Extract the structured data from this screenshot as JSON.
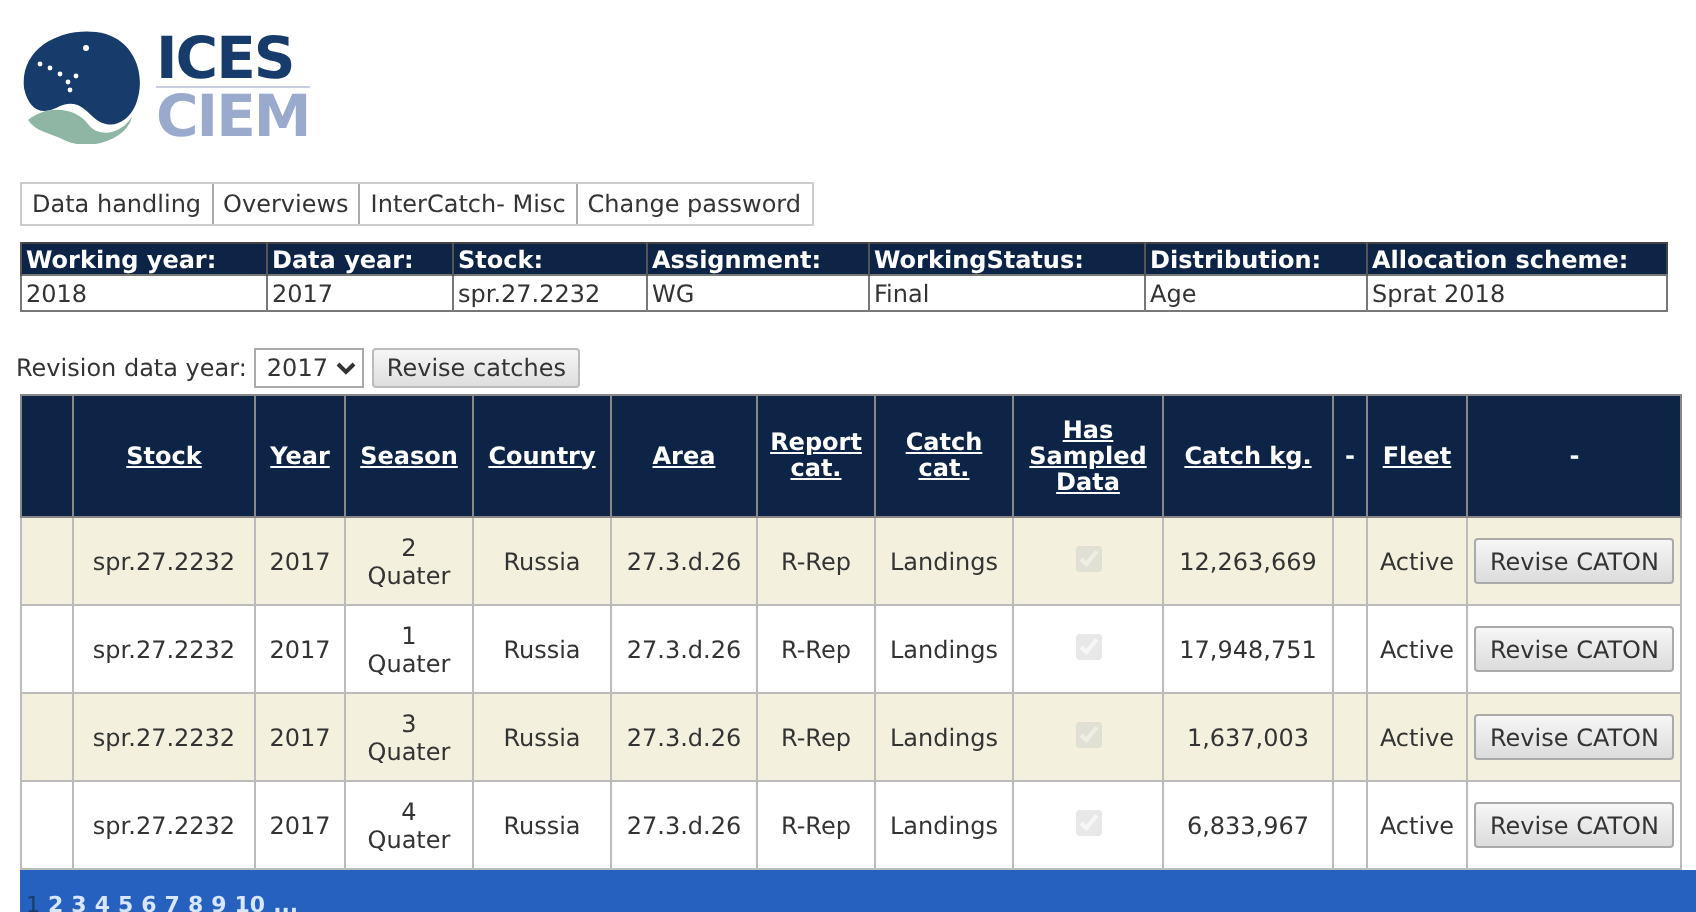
{
  "logo": {
    "line_1": "ICES",
    "line_2": "CIEM"
  },
  "menu": [
    {
      "label": "Data handling"
    },
    {
      "label": "Overviews"
    },
    {
      "label": "InterCatch- Misc"
    },
    {
      "label": "Change password"
    }
  ],
  "info": [
    {
      "label": "Working year:",
      "value": "2018"
    },
    {
      "label": "Data year:",
      "value": "2017"
    },
    {
      "label": "Stock:",
      "value": "spr.27.2232"
    },
    {
      "label": "Assignment:",
      "value": "WG"
    },
    {
      "label": "WorkingStatus:",
      "value": "Final"
    },
    {
      "label": "Distribution:",
      "value": "Age"
    },
    {
      "label": "Allocation scheme:",
      "value": "Sprat 2018"
    }
  ],
  "revision": {
    "label": "Revision data year:",
    "year": "2017",
    "button": "Revise catches"
  },
  "table": {
    "columns": [
      {
        "kind": "blank"
      },
      {
        "label": "Stock",
        "kind": "link"
      },
      {
        "label": "Year",
        "kind": "link"
      },
      {
        "label": "Season",
        "kind": "link"
      },
      {
        "label": "Country",
        "kind": "link"
      },
      {
        "label": "Area",
        "kind": "link"
      },
      {
        "label": "Report cat.",
        "kind": "link"
      },
      {
        "label": "Catch cat.",
        "kind": "link"
      },
      {
        "label": "Has Sampled Data",
        "kind": "link"
      },
      {
        "label": "Catch kg.",
        "kind": "link"
      },
      {
        "label": "-",
        "kind": "text"
      },
      {
        "label": "Fleet",
        "kind": "link"
      },
      {
        "label": "-",
        "kind": "text"
      }
    ],
    "rows": [
      {
        "stock": "spr.27.2232",
        "year": "2017",
        "season_number": "2",
        "season": "Quater",
        "country": "Russia",
        "area": "27.3.d.26",
        "report_cat": "R-Rep",
        "catch_cat": "Landings",
        "has_sampled_data": {
          "checked": true,
          "disabled": true
        },
        "catch_kg": "12,263,669",
        "fleet": "Active",
        "button": "Revise CATON"
      },
      {
        "stock": "spr.27.2232",
        "year": "2017",
        "season_number": "1",
        "season": "Quater",
        "country": "Russia",
        "area": "27.3.d.26",
        "report_cat": "R-Rep",
        "catch_cat": "Landings",
        "has_sampled_data": {
          "checked": true,
          "disabled": true
        },
        "catch_kg": "17,948,751",
        "fleet": "Active",
        "button": "Revise CATON"
      },
      {
        "stock": "spr.27.2232",
        "year": "2017",
        "season_number": "3",
        "season": "Quater",
        "country": "Russia",
        "area": "27.3.d.26",
        "report_cat": "R-Rep",
        "catch_cat": "Landings",
        "has_sampled_data": {
          "checked": true,
          "disabled": true
        },
        "catch_kg": "1,637,003",
        "fleet": "Active",
        "button": "Revise CATON"
      },
      {
        "stock": "spr.27.2232",
        "year": "2017",
        "season_number": "4",
        "season": "Quater",
        "country": "Russia",
        "area": "27.3.d.26",
        "report_cat": "R-Rep",
        "catch_cat": "Landings",
        "has_sampled_data": {
          "checked": true,
          "disabled": true
        },
        "catch_kg": "6,833,967",
        "fleet": "Active",
        "button": "Revise CATON"
      }
    ]
  },
  "pager": [
    {
      "label": "1",
      "selected": true
    },
    {
      "label": "2",
      "selected": false
    },
    {
      "label": "3",
      "selected": false
    },
    {
      "label": "4",
      "selected": false
    },
    {
      "label": "5",
      "selected": false
    },
    {
      "label": "6",
      "selected": false
    },
    {
      "label": "7",
      "selected": false
    },
    {
      "label": "8",
      "selected": false
    },
    {
      "label": "9",
      "selected": false
    },
    {
      "label": "10",
      "selected": false
    },
    {
      "label": "...",
      "selected": false
    }
  ]
}
